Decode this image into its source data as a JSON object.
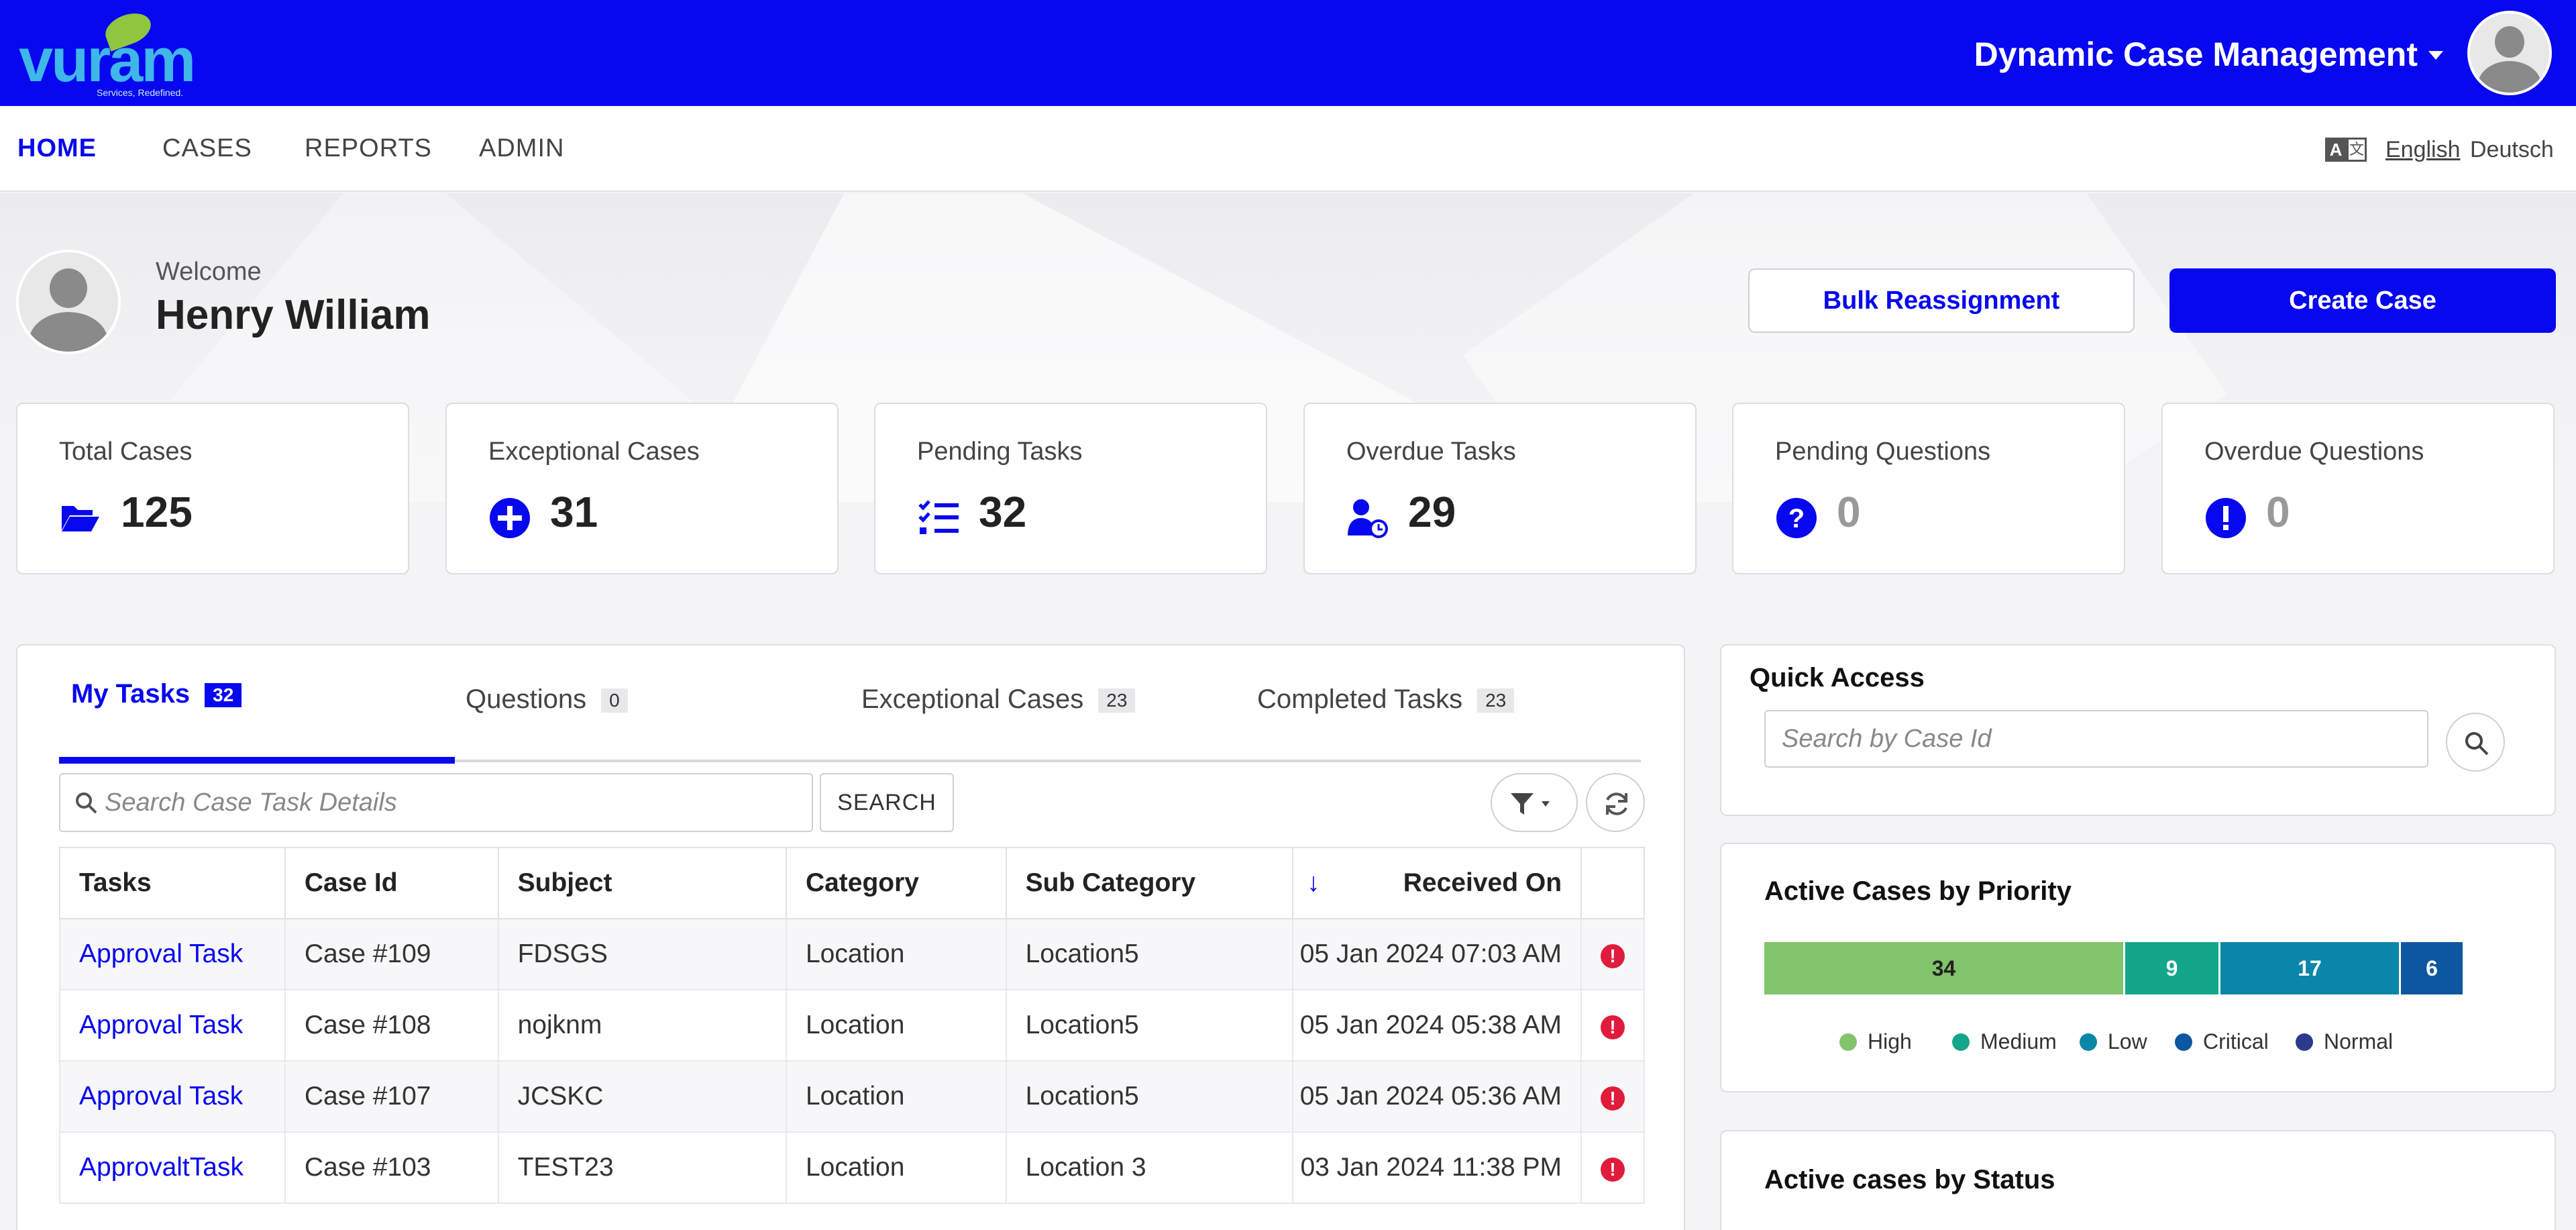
{
  "header": {
    "logo_text": "vuram",
    "logo_tagline": "Services, Redefined.",
    "app_title": "Dynamic Case Management"
  },
  "nav": {
    "items": [
      {
        "label": "HOME",
        "active": true
      },
      {
        "label": "CASES",
        "active": false
      },
      {
        "label": "REPORTS",
        "active": false
      },
      {
        "label": "ADMIN",
        "active": false
      }
    ],
    "languages": [
      "English",
      "Deutsch"
    ],
    "translate_icon": {
      "a": "A",
      "b": "文"
    }
  },
  "welcome": {
    "greeting": "Welcome",
    "user_name": "Henry William"
  },
  "actions": {
    "bulk_reassignment": "Bulk Reassignment",
    "create_case": "Create Case"
  },
  "stats": [
    {
      "label": "Total Cases",
      "value": "125",
      "icon": "folder-open-icon"
    },
    {
      "label": "Exceptional Cases",
      "value": "31",
      "icon": "plus-circle-icon"
    },
    {
      "label": "Pending Tasks",
      "value": "32",
      "icon": "task-list-icon"
    },
    {
      "label": "Overdue Tasks",
      "value": "29",
      "icon": "user-clock-icon"
    },
    {
      "label": "Pending Questions",
      "value": "0",
      "icon": "question-circle-icon"
    },
    {
      "label": "Overdue Questions",
      "value": "0",
      "icon": "exclamation-circle-icon"
    }
  ],
  "tabs": [
    {
      "label": "My Tasks",
      "count": "32",
      "active": true
    },
    {
      "label": "Questions",
      "count": "0",
      "active": false
    },
    {
      "label": "Exceptional Cases",
      "count": "23",
      "active": false
    },
    {
      "label": "Completed Tasks",
      "count": "23",
      "active": false
    }
  ],
  "task_search": {
    "placeholder": "Search Case Task Details",
    "button": "SEARCH"
  },
  "table": {
    "columns": [
      "Tasks",
      "Case Id",
      "Subject",
      "Category",
      "Sub Category",
      "Received On"
    ],
    "sort_indicator": "↓",
    "rows": [
      {
        "task": "Approval Task",
        "case_id": "Case #109",
        "subject": "FDSGS",
        "category": "Location",
        "sub_category": "Location5",
        "received_on": "05 Jan 2024 07:03 AM"
      },
      {
        "task": "Approval Task",
        "case_id": "Case #108",
        "subject": "nojknm",
        "category": "Location",
        "sub_category": "Location5",
        "received_on": "05 Jan 2024 05:38 AM"
      },
      {
        "task": "Approval Task",
        "case_id": "Case #107",
        "subject": "JCSKC",
        "category": "Location",
        "sub_category": "Location5",
        "received_on": "05 Jan 2024 05:36 AM"
      },
      {
        "task": "ApprovaltTask",
        "case_id": "Case #103",
        "subject": "TEST23",
        "category": "Location",
        "sub_category": "Location 3",
        "received_on": "03 Jan 2024 11:38 PM"
      }
    ],
    "alert_symbol": "!"
  },
  "quick_access": {
    "title": "Quick Access",
    "placeholder": "Search by Case Id"
  },
  "priority_panel": {
    "title": "Active Cases by Priority"
  },
  "chart_data": {
    "type": "bar",
    "stacked": true,
    "orientation": "horizontal",
    "categories": [
      ""
    ],
    "series": [
      {
        "name": "High",
        "values": [
          34
        ],
        "color": "#82c46c"
      },
      {
        "name": "Medium",
        "values": [
          9
        ],
        "color": "#14a68a"
      },
      {
        "name": "Low",
        "values": [
          17
        ],
        "color": "#0a86a8"
      },
      {
        "name": "Critical",
        "values": [
          6
        ],
        "color": "#0d56a0"
      },
      {
        "name": "Normal",
        "values": [
          0
        ],
        "color": "#2b3a8c"
      }
    ],
    "title": "Active Cases by Priority",
    "legend": "bottom"
  },
  "status_panel": {
    "title": "Active cases by Status"
  }
}
